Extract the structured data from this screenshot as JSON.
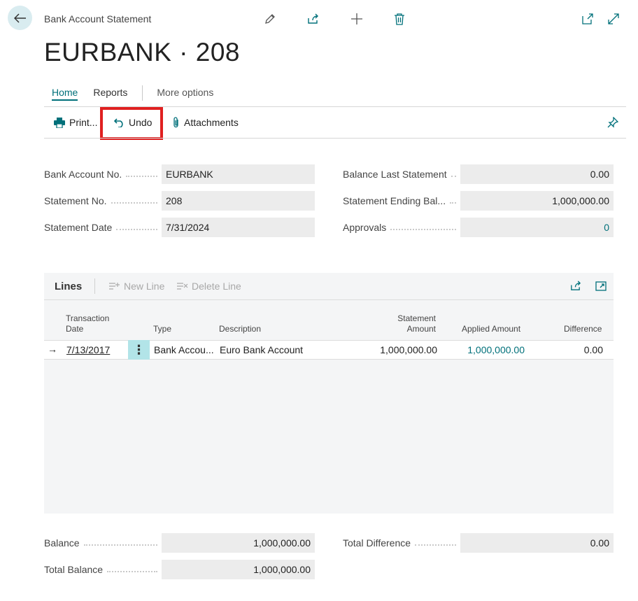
{
  "header": {
    "breadcrumb": "Bank Account Statement",
    "title": "EURBANK · 208"
  },
  "tabs": [
    {
      "label": "Home",
      "active": true
    },
    {
      "label": "Reports",
      "active": false
    },
    {
      "label": "More options",
      "active": false
    }
  ],
  "actions": {
    "print": "Print...",
    "undo": "Undo",
    "attachments": "Attachments"
  },
  "fields": {
    "bank_account_no": {
      "label": "Bank Account No.",
      "value": "EURBANK"
    },
    "statement_no": {
      "label": "Statement No.",
      "value": "208"
    },
    "statement_date": {
      "label": "Statement Date",
      "value": "7/31/2024"
    },
    "balance_last_statement": {
      "label": "Balance Last Statement",
      "value": "0.00"
    },
    "statement_ending_balance": {
      "label": "Statement Ending Bal...",
      "value": "1,000,000.00"
    },
    "approvals": {
      "label": "Approvals",
      "value": "0"
    }
  },
  "lines": {
    "title": "Lines",
    "new_line": "New Line",
    "delete_line": "Delete Line",
    "columns": {
      "transaction_date_1": "Transaction",
      "transaction_date_2": "Date",
      "type": "Type",
      "description": "Description",
      "statement_amount_1": "Statement",
      "statement_amount_2": "Amount",
      "applied_amount": "Applied Amount",
      "difference": "Difference"
    },
    "rows": [
      {
        "arrow": "→",
        "transaction_date": "7/13/2017",
        "type": "Bank Accou...",
        "description": "Euro Bank Account",
        "statement_amount": "1,000,000.00",
        "applied_amount": "1,000,000.00",
        "difference": "0.00"
      }
    ]
  },
  "totals": {
    "balance": {
      "label": "Balance",
      "value": "1,000,000.00"
    },
    "total_balance": {
      "label": "Total Balance",
      "value": "1,000,000.00"
    },
    "total_difference": {
      "label": "Total Difference",
      "value": "0.00"
    }
  },
  "colors": {
    "accent": "#00707a",
    "highlight_box": "#e02020",
    "field_bg": "#ececec"
  }
}
